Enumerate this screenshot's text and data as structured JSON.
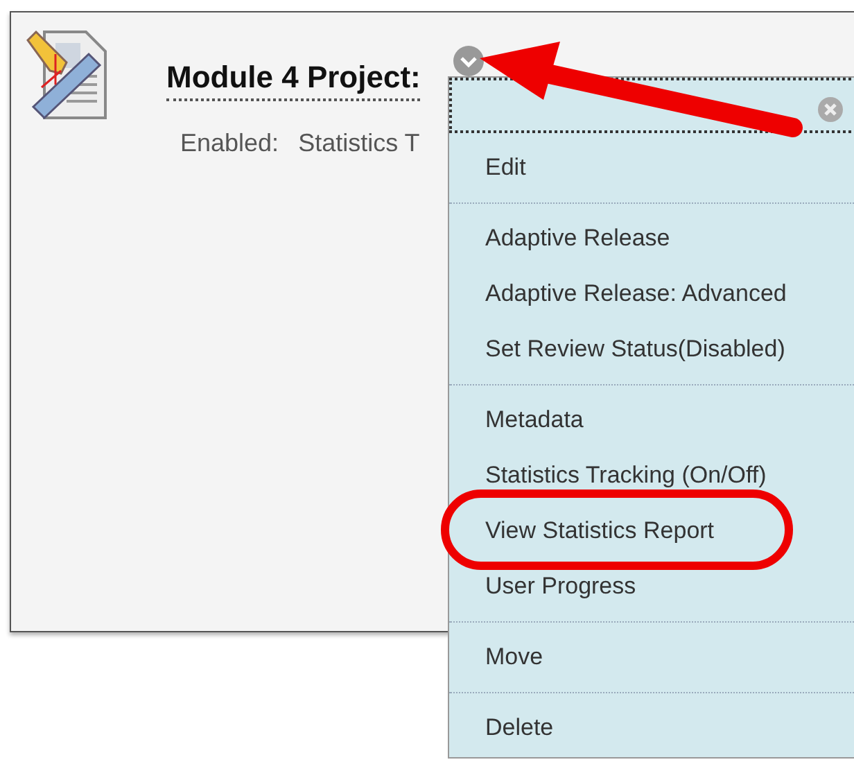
{
  "item": {
    "title": "Module 4 Project:",
    "status_label": "Enabled:",
    "status_value": "Statistics T"
  },
  "menu": {
    "groups": [
      [
        {
          "label": "Edit",
          "circled": false
        }
      ],
      [
        {
          "label": "Adaptive Release",
          "circled": false
        },
        {
          "label": "Adaptive Release: Advanced",
          "circled": false
        },
        {
          "label": "Set Review Status(Disabled)",
          "circled": false
        }
      ],
      [
        {
          "label": "Metadata",
          "circled": false
        },
        {
          "label": "Statistics Tracking (On/Off)",
          "circled": false
        },
        {
          "label": "View Statistics Report",
          "circled": true
        },
        {
          "label": "User Progress",
          "circled": false
        }
      ],
      [
        {
          "label": "Move",
          "circled": false
        }
      ],
      [
        {
          "label": "Delete",
          "circled": false
        }
      ]
    ]
  }
}
